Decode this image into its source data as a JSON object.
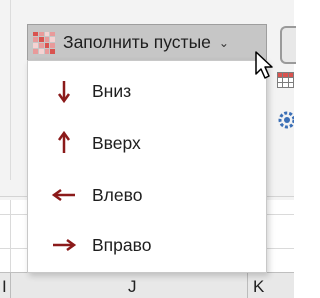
{
  "toolbar": {
    "fill_blanks_label": "Заполнить пустые",
    "fill_blanks_chevron": "⌄"
  },
  "menu": {
    "items": [
      {
        "label": "Вниз",
        "icon": "arrow-down-icon"
      },
      {
        "label": "Вверх",
        "icon": "arrow-up-icon"
      },
      {
        "label": "Влево",
        "icon": "arrow-left-icon"
      },
      {
        "label": "Вправо",
        "icon": "arrow-right-icon"
      }
    ]
  },
  "sheet": {
    "columns": [
      "I",
      "J",
      "K"
    ]
  },
  "colors": {
    "arrow": "#8b1a1a",
    "trigger_bg": "#c6c6c6"
  }
}
